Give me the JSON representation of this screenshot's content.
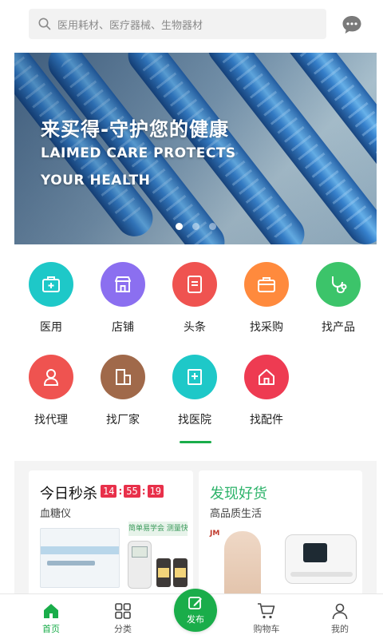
{
  "search": {
    "placeholder": "医用耗材、医疗器械、生物器材",
    "icon": "search-icon"
  },
  "header": {
    "message_icon": "chat-bubble-icon"
  },
  "banner": {
    "title": "来买得-守护您的健康",
    "subtitle_line1": "LAIMED CARE PROTECTS",
    "subtitle_line2": "YOUR HEALTH",
    "slide_count": 3,
    "active_slide": 1
  },
  "categories": [
    {
      "label": "医用",
      "icon": "medical-kit-icon",
      "color": "#1ec8c8"
    },
    {
      "label": "店铺",
      "icon": "store-icon",
      "color": "#8b6ff0"
    },
    {
      "label": "头条",
      "icon": "news-icon",
      "color": "#ef5350"
    },
    {
      "label": "找采购",
      "icon": "briefcase-icon",
      "color": "#ff8a3d"
    },
    {
      "label": "找产品",
      "icon": "stethoscope-icon",
      "color": "#3cc46a"
    },
    {
      "label": "找代理",
      "icon": "agent-person-icon",
      "color": "#ef5350"
    },
    {
      "label": "找厂家",
      "icon": "factory-icon",
      "color": "#a0694a"
    },
    {
      "label": "找医院",
      "icon": "hospital-icon",
      "color": "#1ec8c8"
    },
    {
      "label": "找配件",
      "icon": "home-parts-icon",
      "color": "#ee3b52"
    }
  ],
  "promos": {
    "flash_sale": {
      "title": "今日秒杀",
      "countdown": {
        "hours": "14",
        "minutes": "55",
        "seconds": "19"
      },
      "subtitle": "血糖仪",
      "mini_banner": "简单易学会 测量快又准"
    },
    "discover": {
      "title": "发现好货",
      "subtitle": "高品质生活",
      "brand_mark": "JM"
    }
  },
  "tabbar": {
    "items": [
      {
        "label": "首页",
        "icon": "home-icon",
        "active": true
      },
      {
        "label": "分类",
        "icon": "grid-icon",
        "active": false
      },
      {
        "label": "发布",
        "icon": "edit-icon",
        "active": false
      },
      {
        "label": "购物车",
        "icon": "cart-icon",
        "active": false
      },
      {
        "label": "我的",
        "icon": "profile-icon",
        "active": false
      }
    ]
  },
  "colors": {
    "accent": "#1aad4a",
    "countdown": "#e8304a",
    "discover_title": "#2db36a"
  }
}
